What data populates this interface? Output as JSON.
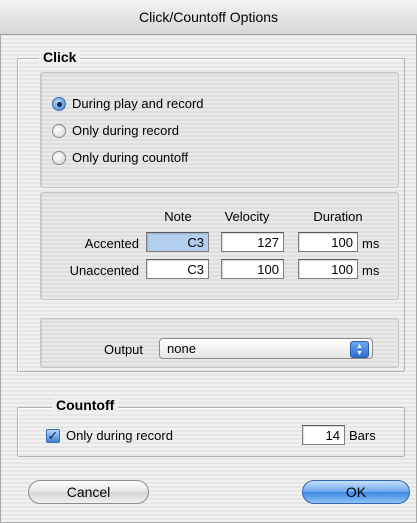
{
  "window": {
    "title": "Click/Countoff Options"
  },
  "click_group": {
    "title": "Click",
    "radios": [
      {
        "label": "During play and record",
        "selected": true
      },
      {
        "label": "Only during record",
        "selected": false
      },
      {
        "label": "Only during countoff",
        "selected": false
      }
    ],
    "columns": {
      "note": "Note",
      "velocity": "Velocity",
      "duration": "Duration"
    },
    "rows": [
      {
        "label": "Accented",
        "note": "C3",
        "velocity": "127",
        "duration": "100",
        "unit": "ms"
      },
      {
        "label": "Unaccented",
        "note": "C3",
        "velocity": "100",
        "duration": "100",
        "unit": "ms"
      }
    ],
    "output": {
      "label": "Output",
      "value": "none"
    }
  },
  "countoff_group": {
    "title": "Countoff",
    "checkbox_label": "Only during record",
    "checked": true,
    "bars_value": "14",
    "bars_unit": "Bars"
  },
  "buttons": {
    "cancel": "Cancel",
    "ok": "OK"
  }
}
